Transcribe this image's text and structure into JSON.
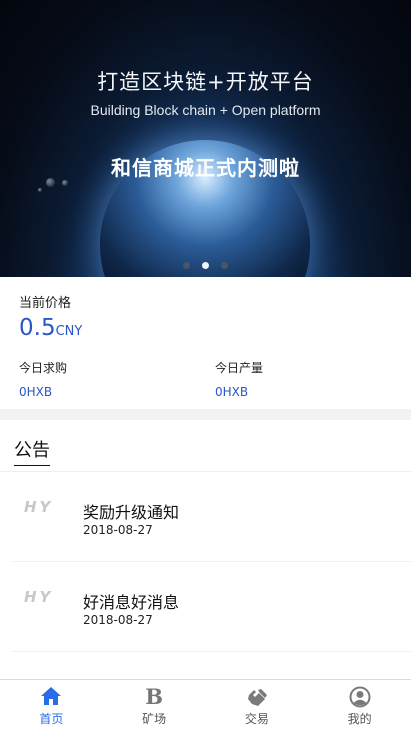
{
  "banner": {
    "title": "打造区块链+开放平台",
    "subtitle": "Building Block chain + Open platform",
    "tagline": "和信商城正式内测啦",
    "slides": 3,
    "active_slide": 2
  },
  "price": {
    "label": "当前价格",
    "value": "0.5",
    "unit": "CNY"
  },
  "stats": {
    "purchase_label": "今日求购",
    "purchase_value": "0HXB",
    "output_label": "今日产量",
    "output_value": "0HXB"
  },
  "notice": {
    "title": "公告",
    "items": [
      {
        "logo": "HY",
        "text": "奖励升级通知",
        "date": "2018-08-27"
      },
      {
        "logo": "HY",
        "text": "好消息好消息",
        "date": "2018-08-27"
      }
    ]
  },
  "tabbar": {
    "tabs": [
      {
        "label": "首页",
        "icon": "home-icon",
        "active": true
      },
      {
        "label": "矿场",
        "icon": "b-icon",
        "active": false
      },
      {
        "label": "交易",
        "icon": "handshake-icon",
        "active": false
      },
      {
        "label": "我的",
        "icon": "user-icon",
        "active": false
      }
    ]
  },
  "colors": {
    "accent": "#2a6de8",
    "price_blue": "#2a56c6"
  }
}
